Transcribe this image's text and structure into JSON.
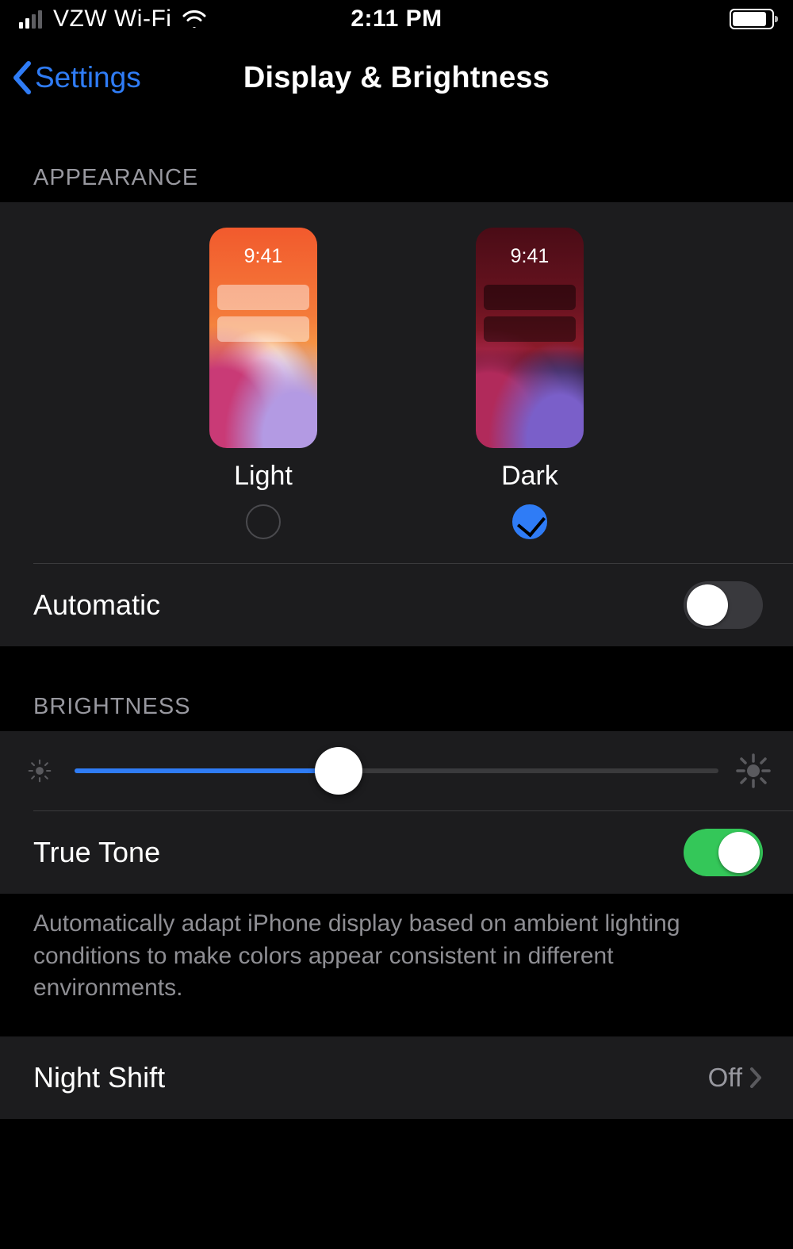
{
  "status": {
    "carrier": "VZW Wi-Fi",
    "time": "2:11 PM",
    "battery_pct": 80,
    "signal_active_bars": 2
  },
  "nav": {
    "back_label": "Settings",
    "title": "Display & Brightness"
  },
  "appearance": {
    "header": "APPEARANCE",
    "preview_time": "9:41",
    "light_label": "Light",
    "dark_label": "Dark",
    "selected": "dark",
    "automatic_label": "Automatic",
    "automatic_on": false
  },
  "brightness": {
    "header": "BRIGHTNESS",
    "value_pct": 41,
    "true_tone_label": "True Tone",
    "true_tone_on": true,
    "true_tone_footer": "Automatically adapt iPhone display based on ambient lighting conditions to make colors appear consistent in different environments."
  },
  "night_shift": {
    "label": "Night Shift",
    "value": "Off"
  },
  "colors": {
    "accent": "#2f7cf6",
    "switch_on": "#34c759",
    "group_bg": "#1c1c1e"
  }
}
